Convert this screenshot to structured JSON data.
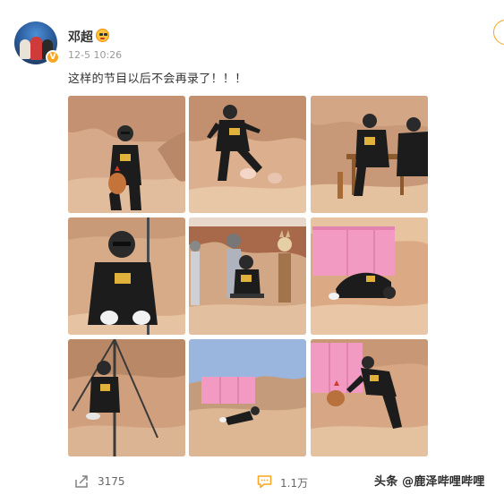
{
  "post": {
    "username": "邓超",
    "timestamp": "12-5 10:26",
    "text": "这样的节目以后不会再录了！！！",
    "verified_badge": "V"
  },
  "icons": {
    "avatar": "avatar",
    "verified": "verified-v-icon",
    "emoji": "emoji-badge-icon",
    "follow": "follow-circle-icon",
    "share": "share-icon",
    "comment": "comment-icon"
  },
  "photos": [
    {
      "label": "man holding chicken in desert"
    },
    {
      "label": "man running with small pig"
    },
    {
      "label": "man sitting at table covering face"
    },
    {
      "label": "close-up man crouching"
    },
    {
      "label": "man seated with masked figures"
    },
    {
      "label": "man bowing near pink container"
    },
    {
      "label": "man crouching near tripod"
    },
    {
      "label": "man sliding near pink container"
    },
    {
      "label": "man chasing chicken"
    }
  ],
  "actions": {
    "share_count": "3175",
    "comment_count": "1.1万"
  },
  "watermark": "头条 @鹿泽哔哩哔哩",
  "colors": {
    "accent_orange": "#f5a623",
    "sand": "#d8ab88",
    "pink_container": "#f29ac2"
  }
}
